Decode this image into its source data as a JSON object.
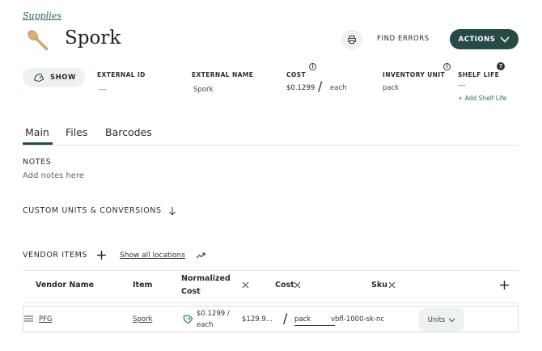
{
  "breadcrumb": "Supplies",
  "title": "Spork",
  "header": {
    "find_errors": "FIND ERRORS",
    "actions": "ACTIONS"
  },
  "show_button": "SHOW",
  "fields": {
    "external_id": {
      "label": "EXTERNAL ID",
      "value": "---"
    },
    "external_name": {
      "label": "EXTERNAL NAME",
      "value": "Spork"
    },
    "cost": {
      "label": "COST",
      "value": "$0.1299",
      "per": "each"
    },
    "inventory_unit": {
      "label": "INVENTORY UNIT",
      "value": "pack"
    },
    "shelf_life": {
      "label": "SHELF LIFE",
      "value": "---",
      "add_link": "+ Add Shelf Life"
    }
  },
  "tabs": [
    "Main",
    "Files",
    "Barcodes"
  ],
  "notes": {
    "label": "NOTES",
    "placeholder": "Add notes here"
  },
  "custom_units": "CUSTOM UNITS & CONVERSIONS",
  "vendor": {
    "label": "VENDOR ITEMS",
    "show_all": "Show all locations",
    "columns": [
      "Vendor Name",
      "Item",
      "Normalized Cost",
      "Cost",
      "Sku"
    ],
    "rows": [
      {
        "vendor": "PFG",
        "item": "Spork",
        "normalized_cost": "$0.1299 / each",
        "cost": "$129.9...",
        "unit": "pack",
        "sku": "vbfl-1000-sk-nc",
        "units_btn": "Units"
      }
    ]
  }
}
